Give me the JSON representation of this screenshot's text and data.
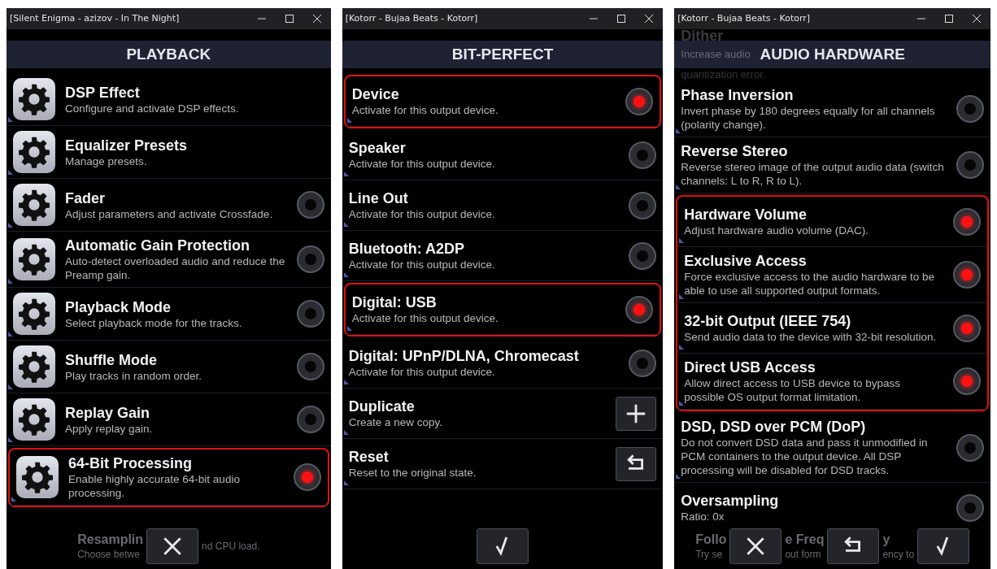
{
  "windows": [
    {
      "title": "[Silent Enigma - azizov - In The Night]",
      "header": "PLAYBACK",
      "gear_icons": true,
      "rows": [
        {
          "kind": "link",
          "title": "DSP Effect",
          "description": "Configure and activate DSP effects.",
          "highlighted": false
        },
        {
          "kind": "link",
          "title": "Equalizer Presets",
          "description": "Manage presets.",
          "highlighted": false
        },
        {
          "kind": "toggle",
          "title": "Fader",
          "description": "Adjust parameters and activate Crossfade.",
          "on": false,
          "highlighted": false
        },
        {
          "kind": "toggle",
          "title": "Automatic Gain Protection",
          "description": "Auto-detect overloaded audio and reduce the Preamp gain.",
          "on": false,
          "highlighted": false
        },
        {
          "kind": "toggle",
          "title": "Playback Mode",
          "description": "Select playback mode for the tracks.",
          "on": false,
          "highlighted": false
        },
        {
          "kind": "toggle",
          "title": "Shuffle Mode",
          "description": "Play tracks in random order.",
          "on": false,
          "highlighted": false
        },
        {
          "kind": "toggle",
          "title": "Replay Gain",
          "description": "Apply replay gain.",
          "on": false,
          "highlighted": false
        },
        {
          "kind": "toggle",
          "title": "64-Bit Processing",
          "description": "Enable highly accurate 64-bit audio processing.",
          "on": true,
          "highlighted": true
        }
      ],
      "footer": [
        {
          "kind": "faded",
          "title": "Resamplin",
          "description": "Choose betwe"
        },
        {
          "kind": "close"
        },
        {
          "kind": "faded",
          "description": "nd CPU load."
        }
      ]
    },
    {
      "title": "[Kotorr - Bujaa Beats - Kotorr]",
      "header": "BIT-PERFECT",
      "rows": [
        {
          "kind": "toggle",
          "title": "Device",
          "description": "Activate for this output device.",
          "on": true,
          "highlighted": true
        },
        {
          "kind": "toggle",
          "title": "Speaker",
          "description": "Activate for this output device.",
          "on": false,
          "highlighted": false
        },
        {
          "kind": "toggle",
          "title": "Line Out",
          "description": "Activate for this output device.",
          "on": false,
          "highlighted": false
        },
        {
          "kind": "toggle",
          "title": "Bluetooth: A2DP",
          "description": "Activate for this output device.",
          "on": false,
          "highlighted": false
        },
        {
          "kind": "toggle",
          "title": "Digital: USB",
          "description": "Activate for this output device.",
          "on": true,
          "highlighted": true
        },
        {
          "kind": "toggle",
          "title": "Digital: UPnP/DLNA, Chromecast",
          "description": "Activate for this output device.",
          "on": false,
          "highlighted": false
        },
        {
          "kind": "plus",
          "title": "Duplicate",
          "description": "Create a new copy.",
          "highlighted": false
        },
        {
          "kind": "reset",
          "title": "Reset",
          "description": "Reset to the original state.",
          "highlighted": false
        }
      ],
      "footer": [
        {
          "kind": "confirm"
        }
      ]
    },
    {
      "title": "[Kotorr - Bujaa Beats - Kotorr]",
      "header": "AUDIO HARDWARE",
      "behind_header": {
        "title": "Dither",
        "description_left": "Increase audio",
        "description_below": "quantization error."
      },
      "rows": [
        {
          "kind": "toggle",
          "title": "Phase Inversion",
          "description": "Invert phase by 180 degrees equally for all channels (polarity change).",
          "on": false,
          "highlighted": false
        },
        {
          "kind": "toggle",
          "title": "Reverse Stereo",
          "description": "Reverse stereo image of the output audio data (switch channels: L to R, R to L).",
          "on": false,
          "highlighted": false
        },
        {
          "kind": "toggle",
          "title": "Hardware Volume",
          "description": "Adjust hardware audio volume (DAC).",
          "on": true,
          "highlighted": true
        },
        {
          "kind": "toggle",
          "title": "Exclusive Access",
          "description": "Force exclusive access to the audio hardware to be able to use all supported output formats.",
          "on": true,
          "highlighted": true
        },
        {
          "kind": "toggle",
          "title": "32-bit Output (IEEE 754)",
          "description": "Send audio data to the device with 32-bit resolution.",
          "on": true,
          "highlighted": true
        },
        {
          "kind": "toggle",
          "title": "Direct USB Access",
          "description": "Allow direct access to USB device to bypass possible OS output format limitation.",
          "on": true,
          "highlighted": true
        },
        {
          "kind": "toggle",
          "title": "DSD, DSD over PCM (DoP)",
          "description": "Do not convert DSD data and pass it unmodified in PCM containers to the output device. All DSP processing will be disabled for DSD tracks.",
          "on": false,
          "highlighted": false
        },
        {
          "kind": "toggle",
          "title": "Oversampling",
          "description": "Ratio: 0x",
          "on": false,
          "highlighted": false
        }
      ],
      "footer": [
        {
          "kind": "faded",
          "title": "Follo",
          "description": "Try se"
        },
        {
          "kind": "close"
        },
        {
          "kind": "faded",
          "title": "e Freq",
          "description": "out form"
        },
        {
          "kind": "reset"
        },
        {
          "kind": "faded",
          "title": "y",
          "description": "ency to"
        },
        {
          "kind": "confirm"
        }
      ]
    }
  ]
}
